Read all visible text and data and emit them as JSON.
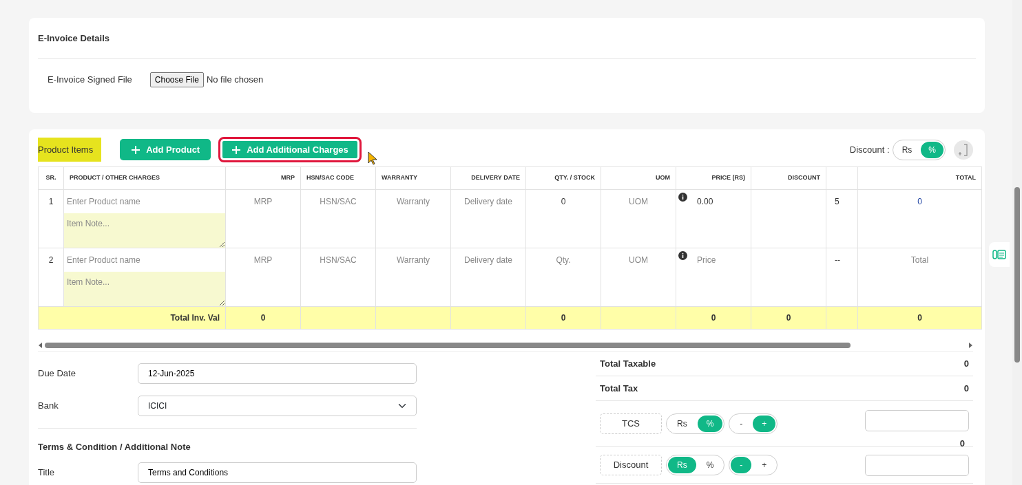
{
  "einvoice": {
    "title": "E-Invoice Details",
    "field_label": "E-Invoice Signed File",
    "file_button": "Choose File",
    "file_status": "No file chosen"
  },
  "product_items": {
    "title": "Product Items",
    "buttons": [
      {
        "label": "Add Product",
        "highlighted": false
      },
      {
        "label": "Add Additional Charges",
        "highlighted": true
      }
    ],
    "discount_label": "Discount :",
    "discount_toggle": [
      {
        "label": "Rs",
        "selected": false
      },
      {
        "label": "%",
        "selected": true
      }
    ]
  },
  "table": {
    "columns": [
      "SR.",
      "PRODUCT / OTHER CHARGES",
      "MRP",
      "HSN/SAC CODE",
      "WARRANTY",
      "DELIVERY DATE",
      "QTY. / STOCK",
      "UOM",
      "PRICE (RS)",
      "DISCOUNT",
      "",
      "TOTAL"
    ],
    "rows": [
      {
        "cells": [
          {
            "kind": "number",
            "text": "1"
          },
          {
            "kind": "product",
            "placeholder": "Enter Product name",
            "note_placeholder": "Item Note..."
          },
          {
            "kind": "input",
            "placeholder": "MRP"
          },
          {
            "kind": "input",
            "placeholder": "HSN/SAC"
          },
          {
            "kind": "input",
            "placeholder": "Warranty"
          },
          {
            "kind": "input",
            "placeholder": "Delivery date"
          },
          {
            "kind": "input",
            "value": "0"
          },
          {
            "kind": "input",
            "placeholder": "UOM"
          },
          {
            "kind": "price",
            "value": "0.00"
          },
          {
            "kind": "input"
          },
          {
            "kind": "text",
            "text": "5"
          },
          {
            "kind": "link",
            "text": "0"
          }
        ]
      },
      {
        "cells": [
          {
            "kind": "number",
            "text": "2"
          },
          {
            "kind": "product",
            "placeholder": "Enter Product name",
            "note_placeholder": "Item Note..."
          },
          {
            "kind": "input",
            "placeholder": "MRP"
          },
          {
            "kind": "input",
            "placeholder": "HSN/SAC"
          },
          {
            "kind": "input",
            "placeholder": "Warranty"
          },
          {
            "kind": "input",
            "placeholder": "Delivery date"
          },
          {
            "kind": "input",
            "placeholder": "Qty."
          },
          {
            "kind": "input",
            "placeholder": "UOM"
          },
          {
            "kind": "price",
            "placeholder": "Price"
          },
          {
            "kind": "input"
          },
          {
            "kind": "text",
            "text": "--"
          },
          {
            "kind": "input",
            "placeholder": "Total"
          }
        ]
      }
    ],
    "totals": {
      "cells": [
        {
          "text": "Total Inv. Val",
          "colspan": 2
        },
        {
          "text": "0"
        },
        {},
        {},
        {},
        {
          "text": "0"
        },
        {},
        {
          "text": "0"
        },
        {
          "text": "0"
        },
        {},
        {
          "text": "0"
        }
      ]
    }
  },
  "details": [
    {
      "kind": "input",
      "label": "Due Date",
      "value": "12-Jun-2025"
    },
    {
      "kind": "select",
      "label": "Bank",
      "value": "ICICI"
    }
  ],
  "terms": {
    "title": "Terms & Condition / Additional Note",
    "fields": [
      {
        "label": "Title",
        "value": "Terms and Conditions"
      }
    ]
  },
  "summary": [
    {
      "label": "Total Taxable",
      "value": "0"
    },
    {
      "label": "Total Tax",
      "value": "0"
    }
  ],
  "adjustments": [
    {
      "label": "TCS",
      "units": [
        {
          "label": "Rs",
          "selected": false
        },
        {
          "label": "%",
          "selected": true
        }
      ],
      "signs": [
        {
          "label": "-",
          "selected": false
        },
        {
          "label": "+",
          "selected": true
        }
      ],
      "amount": "0"
    },
    {
      "label": "Discount",
      "units": [
        {
          "label": "Rs",
          "selected": true
        },
        {
          "label": "%",
          "selected": false
        }
      ],
      "signs": [
        {
          "label": "-",
          "selected": true
        },
        {
          "label": "+",
          "selected": false
        }
      ]
    }
  ]
}
